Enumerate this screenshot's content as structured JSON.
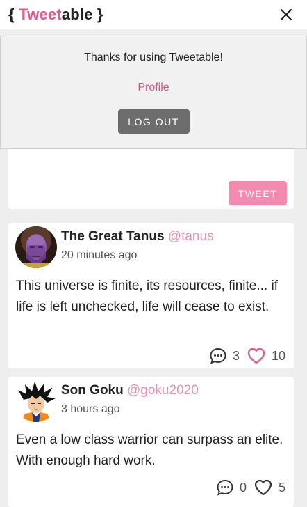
{
  "header": {
    "logo_open": "{ ",
    "logo_tweet": "Tweet",
    "logo_able": "able",
    "logo_close": " }",
    "close_icon": "close-icon"
  },
  "menu": {
    "thanks": "Thanks for using Tweetable!",
    "profile": "Profile",
    "logout": "LOG OUT"
  },
  "compose": {
    "tweet_button": "TWEET"
  },
  "tweets": [
    {
      "name": "The Great Tanus",
      "handle": "@tanus",
      "time": "20 minutes ago",
      "text": "This universe is finite, its resources, finite... if life is left unchecked, life will cease to exist.",
      "comments": "3",
      "likes": "10",
      "liked": true
    },
    {
      "name": "Son Goku",
      "handle": "@goku2020",
      "time": "3 hours ago",
      "text": "Even a low class warrior can surpass an elite. With enough hard work.",
      "comments": "0",
      "likes": "5",
      "liked": false
    }
  ],
  "colors": {
    "accent": "#e05a8c",
    "tweet_button": "#f38ab0",
    "logout_button": "#6d6d6d",
    "liked_heart": "#e05a8c",
    "background": "#eeeeee"
  }
}
